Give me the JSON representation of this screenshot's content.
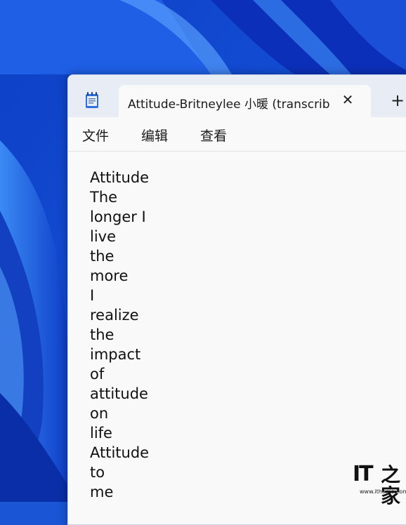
{
  "tab": {
    "title": "Attitude-Britneylee 小暖 (transcrib",
    "close_glyph": "✕",
    "new_tab_glyph": "+"
  },
  "menu": [
    "文件",
    "编辑",
    "查看"
  ],
  "editor": {
    "lines": [
      "Attitude",
      "The",
      "longer I",
      "live",
      "the",
      "more",
      "I",
      "realize",
      "the",
      "impact",
      "of",
      "attitude",
      "on",
      "life",
      "Attitude",
      "to",
      "me"
    ]
  },
  "watermark": {
    "mark": "IT",
    "cn": "之家",
    "url": "www.ithome.com"
  },
  "colors": {
    "wallpaper_dark": "#0b2fb8",
    "wallpaper_light": "#2f7af0",
    "titlebar": "#e8edf5",
    "editor_bg": "#f9f9f9"
  },
  "icons": [
    "notepad-icon",
    "close-icon",
    "plus-icon"
  ]
}
